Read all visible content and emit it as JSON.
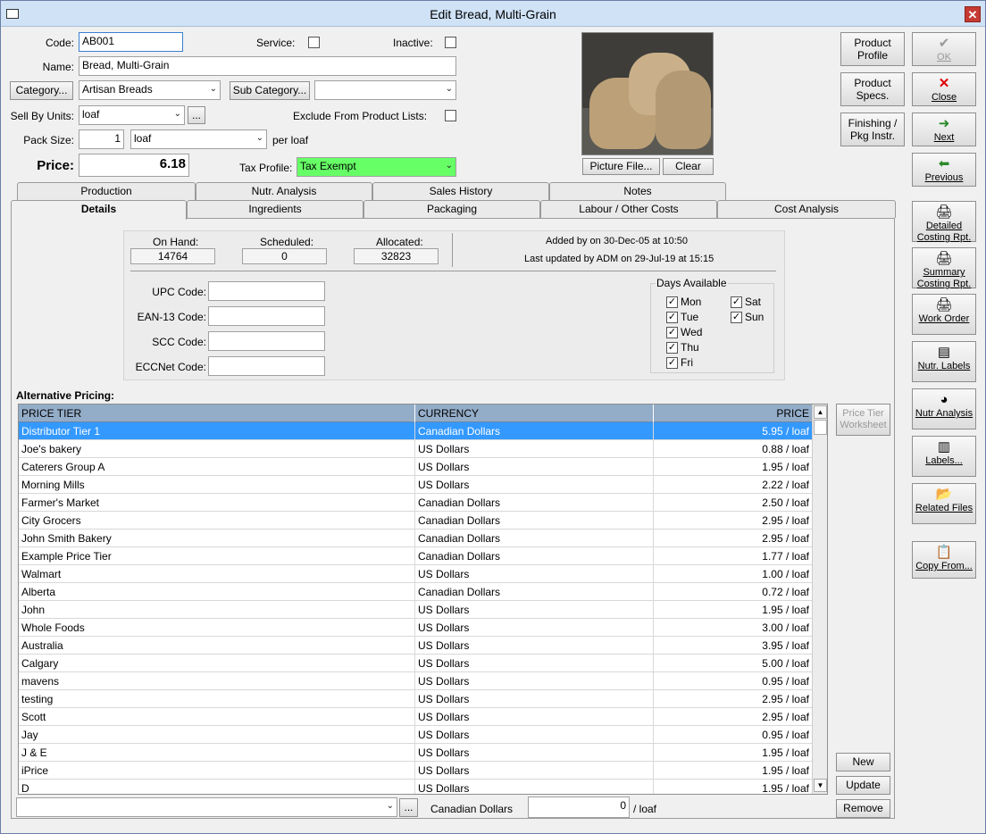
{
  "window": {
    "title": "Edit Bread, Multi-Grain",
    "close": "✕"
  },
  "form": {
    "code_label": "Code:",
    "code_value": "AB001",
    "service_label": "Service:",
    "inactive_label": "Inactive:",
    "name_label": "Name:",
    "name_value": "Bread, Multi-Grain",
    "category_button": "Category...",
    "category_value": "Artisan Breads",
    "subcategory_button": "Sub Category...",
    "subcategory_value": "",
    "sell_by_label": "Sell By Units:",
    "sell_by_value": "loaf",
    "ellipsis": "...",
    "exclude_label": "Exclude From Product Lists:",
    "pack_size_label": "Pack Size:",
    "pack_size_value": "1",
    "pack_unit_value": "loaf",
    "per_loaf": "per loaf",
    "price_label": "Price:",
    "price_value": "6.18",
    "tax_label": "Tax Profile:",
    "tax_value": "Tax Exempt",
    "picture_button": "Picture File...",
    "clear_button": "Clear"
  },
  "right_buttons": {
    "product_profile": "Product\nProfile",
    "product_specs": "Product\nSpecs.",
    "finishing": "Finishing /\nPkg Instr.",
    "ok": "OK",
    "close": "Close",
    "next": "Next",
    "previous": "Previous"
  },
  "tabs_row1": [
    "Production",
    "Nutr. Analysis",
    "Sales History",
    "Notes"
  ],
  "tabs_row2": [
    "Details",
    "Ingredients",
    "Packaging",
    "Labour / Other Costs",
    "Cost Analysis"
  ],
  "details": {
    "on_hand_label": "On Hand:",
    "on_hand": "14764",
    "scheduled_label": "Scheduled:",
    "scheduled": "0",
    "allocated_label": "Allocated:",
    "allocated": "32823",
    "added_by": "Added by  on 30-Dec-05 at 10:50",
    "updated_by": "Last updated by ADM on 29-Jul-19 at 15:15",
    "upc_label": "UPC Code:",
    "ean_label": "EAN-13 Code:",
    "scc_label": "SCC Code:",
    "eccnet_label": "ECCNet Code:",
    "days_title": "Days Available",
    "days": [
      "Mon",
      "Tue",
      "Wed",
      "Thu",
      "Fri",
      "Sat",
      "Sun"
    ]
  },
  "alt_pricing": {
    "title": "Alternative Pricing:",
    "columns": [
      "PRICE TIER",
      "CURRENCY",
      "PRICE"
    ],
    "rows": [
      [
        "Distributor Tier 1",
        "Canadian Dollars",
        "5.95 / loaf"
      ],
      [
        "Joe's bakery",
        "US Dollars",
        "0.88 / loaf"
      ],
      [
        "Caterers Group A",
        "US Dollars",
        "1.95 / loaf"
      ],
      [
        "Morning Mills",
        "US Dollars",
        "2.22 / loaf"
      ],
      [
        "Farmer's Market",
        "Canadian Dollars",
        "2.50 / loaf"
      ],
      [
        "City Grocers",
        "Canadian Dollars",
        "2.95 / loaf"
      ],
      [
        "John Smith Bakery",
        "Canadian Dollars",
        "2.95 / loaf"
      ],
      [
        "Example Price Tier",
        "Canadian Dollars",
        "1.77 / loaf"
      ],
      [
        "Walmart",
        "US Dollars",
        "1.00 / loaf"
      ],
      [
        "Alberta",
        "Canadian Dollars",
        "0.72 / loaf"
      ],
      [
        "John",
        "US Dollars",
        "1.95 / loaf"
      ],
      [
        "Whole Foods",
        "US Dollars",
        "3.00 / loaf"
      ],
      [
        "Australia",
        "US Dollars",
        "3.95 / loaf"
      ],
      [
        "Calgary",
        "US Dollars",
        "5.00 / loaf"
      ],
      [
        "mavens",
        "US Dollars",
        "0.95 / loaf"
      ],
      [
        "testing",
        "US Dollars",
        "2.95 / loaf"
      ],
      [
        "Scott",
        "US Dollars",
        "2.95 / loaf"
      ],
      [
        "Jay",
        "US Dollars",
        "0.95 / loaf"
      ],
      [
        "J & E",
        "US Dollars",
        "1.95 / loaf"
      ],
      [
        "iPrice",
        "US Dollars",
        "1.95 / loaf"
      ],
      [
        "D",
        "US Dollars",
        "1.95 / loaf"
      ]
    ],
    "worksheet_button": "Price Tier\nWorksheet",
    "new_button": "New",
    "update_button": "Update",
    "remove_button": "Remove",
    "bottom_currency": "Canadian Dollars",
    "bottom_price": "0",
    "bottom_unit": "/ loaf",
    "bottom_ellipsis": "..."
  },
  "side_buttons": [
    "Detailed\nCosting Rpt.",
    "Summary\nCosting Rpt.",
    "Work Order",
    "Nutr. Labels",
    "Nutr Analysis",
    "Labels...",
    "Related Files",
    "Copy From..."
  ],
  "colors": {
    "tax_green": "#66ff66",
    "selection": "#3399ff",
    "header": "#93acc8"
  }
}
